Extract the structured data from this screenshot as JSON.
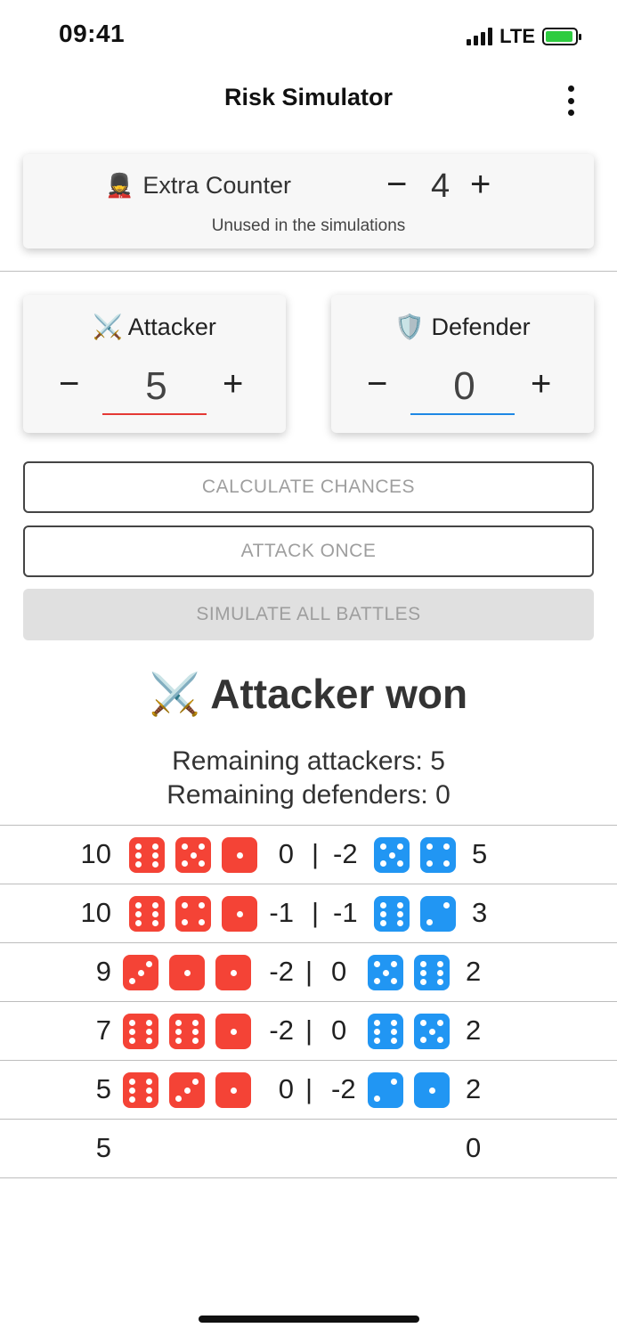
{
  "status": {
    "time": "09:41",
    "network": "LTE"
  },
  "app": {
    "title": "Risk Simulator"
  },
  "extra_counter": {
    "emoji": "💂",
    "label": "Extra Counter",
    "value": "4",
    "subtitle": "Unused in the simulations",
    "minus": "−",
    "plus": "+"
  },
  "attacker": {
    "emoji": "⚔️",
    "label": "Attacker",
    "value": "5",
    "minus": "−",
    "plus": "+"
  },
  "defender": {
    "emoji": "🛡️",
    "label": "Defender",
    "value": "0",
    "minus": "−",
    "plus": "+"
  },
  "buttons": {
    "calculate": "CALCULATE CHANCES",
    "attack_once": "ATTACK ONCE",
    "simulate_all": "SIMULATE ALL BATTLES"
  },
  "result": {
    "emoji": "⚔️",
    "title": "Attacker won",
    "remaining_attackers": "Remaining attackers: 5",
    "remaining_defenders": "Remaining defenders: 0"
  },
  "colors": {
    "attacker_dice": "#f44336",
    "defender_dice": "#2196f3"
  },
  "battle_log": [
    {
      "attackers": "10",
      "attacker_dice": [
        6,
        5,
        1
      ],
      "attacker_loss": "0",
      "separator": "|",
      "defender_loss": "-2",
      "defender_dice": [
        5,
        4
      ],
      "defenders": "5"
    },
    {
      "attackers": "10",
      "attacker_dice": [
        6,
        4,
        1
      ],
      "attacker_loss": "-1",
      "separator": "|",
      "defender_loss": "-1",
      "defender_dice": [
        6,
        2
      ],
      "defenders": "3"
    },
    {
      "attackers": "9",
      "attacker_dice": [
        3,
        1,
        1
      ],
      "attacker_loss": "-2",
      "separator": "|",
      "defender_loss": "0",
      "defender_dice": [
        5,
        6
      ],
      "defenders": "2"
    },
    {
      "attackers": "7",
      "attacker_dice": [
        6,
        6,
        1
      ],
      "attacker_loss": "-2",
      "separator": "|",
      "defender_loss": "0",
      "defender_dice": [
        6,
        5
      ],
      "defenders": "2"
    },
    {
      "attackers": "5",
      "attacker_dice": [
        6,
        3,
        1
      ],
      "attacker_loss": "0",
      "separator": "|",
      "defender_loss": "-2",
      "defender_dice": [
        2,
        1
      ],
      "defenders": "2"
    },
    {
      "attackers": "5",
      "attacker_dice": [],
      "attacker_loss": "",
      "separator": "",
      "defender_loss": "",
      "defender_dice": [],
      "defenders": "0"
    }
  ]
}
